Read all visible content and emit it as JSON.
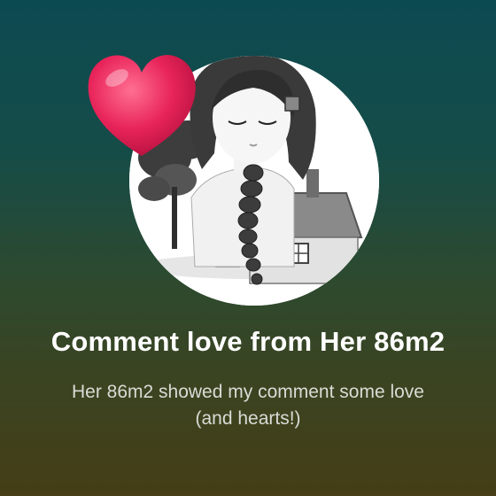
{
  "notification": {
    "title": "Comment love from Her 86m2",
    "message": "Her 86m2 showed my comment some love (and hearts!)",
    "avatar_icon": "illustrated-girl-avatar-icon",
    "heart_icon": "heart-icon"
  },
  "colors": {
    "background_top": "#0c4a52",
    "background_bottom": "#453e16",
    "heart": "#e8245a",
    "title_text": "#ffffff",
    "message_text": "#d8dcd6"
  }
}
